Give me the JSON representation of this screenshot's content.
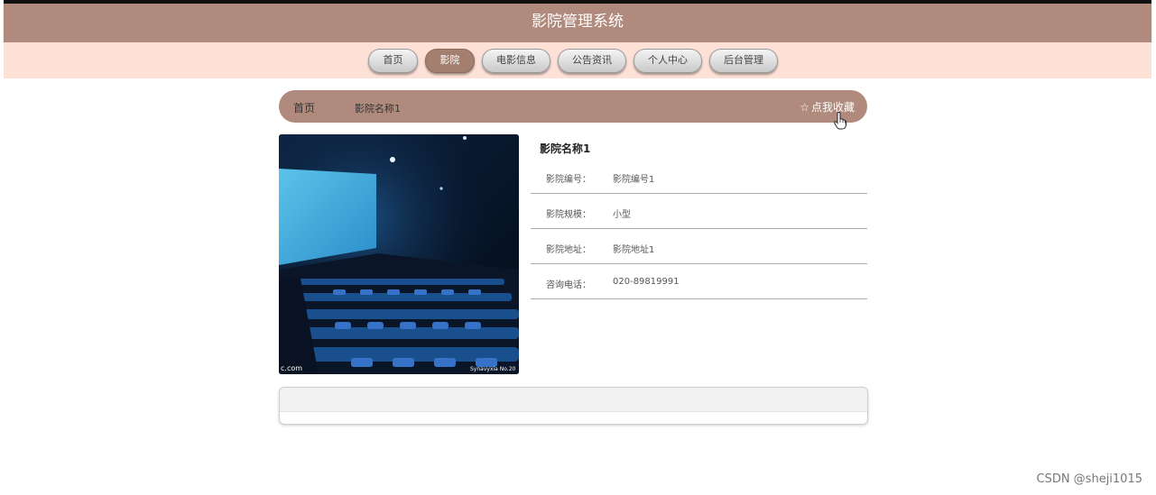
{
  "header": {
    "title": "影院管理系统"
  },
  "nav": {
    "items": [
      {
        "label": "首页",
        "active": false
      },
      {
        "label": "影院",
        "active": true
      },
      {
        "label": "电影信息",
        "active": false
      },
      {
        "label": "公告资讯",
        "active": false
      },
      {
        "label": "个人中心",
        "active": false
      },
      {
        "label": "后台管理",
        "active": false
      }
    ]
  },
  "breadcrumb": {
    "home": "首页",
    "current": "影院名称1"
  },
  "favorite": {
    "icon": "star-outline-icon",
    "label": "点我收藏"
  },
  "detail": {
    "image_icon": "cinema-hall-photo",
    "name": "影院名称1",
    "fields": [
      {
        "label": "影院编号：",
        "value": "影院编号1"
      },
      {
        "label": "影院规模：",
        "value": "小型"
      },
      {
        "label": "影院地址：",
        "value": "影院地址1"
      },
      {
        "label": "咨询电话：",
        "value": "020-89819991"
      }
    ]
  },
  "image_captions": {
    "left": "c.com",
    "right": "Synavyxia  No.20"
  },
  "watermark": "CSDN @sheji1015",
  "colors": {
    "header": "#b08a7c",
    "nav_band": "#fde0d6",
    "active_tab": "#a47f70"
  }
}
